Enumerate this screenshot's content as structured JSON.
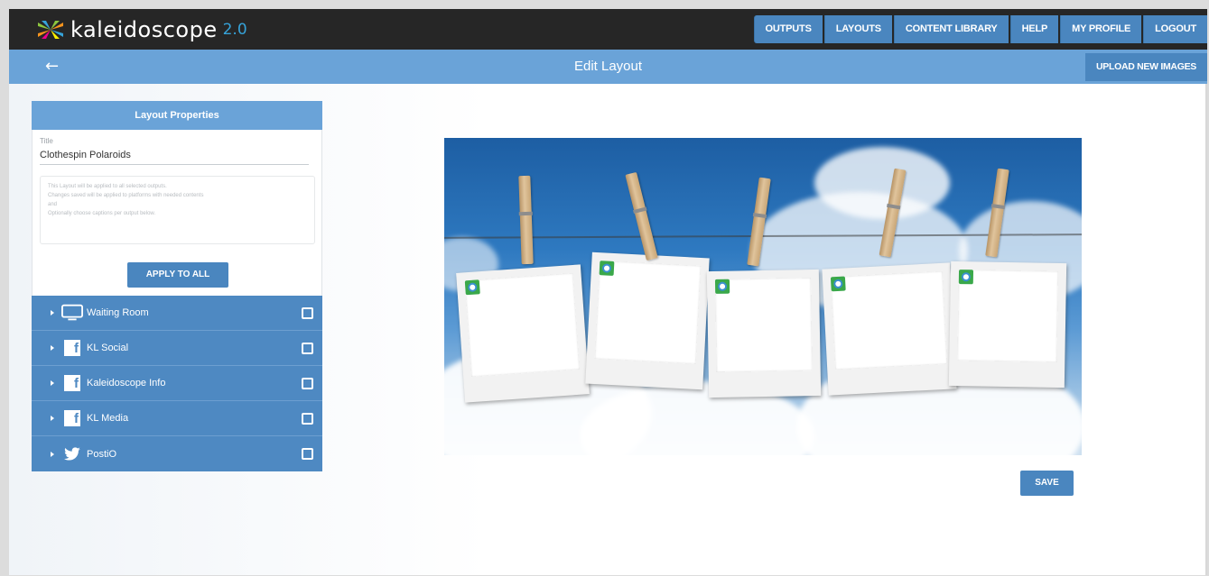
{
  "brand": {
    "name": "kaleidoscope",
    "version": "2.0",
    "logo_icon": "kaleidoscope-logo-icon"
  },
  "nav": [
    {
      "label": "OUTPUTS"
    },
    {
      "label": "LAYOUTS"
    },
    {
      "label": "CONTENT LIBRARY"
    },
    {
      "label": "HELP"
    },
    {
      "label": "MY PROFILE"
    },
    {
      "label": "LOGOUT"
    }
  ],
  "subbar": {
    "back_icon": "←",
    "title": "Edit Layout",
    "upload_label": "UPLOAD NEW IMAGES"
  },
  "layout_properties": {
    "header": "Layout Properties",
    "title_label": "Title",
    "title_value": "Clothespin Polaroids",
    "description_lines": [
      "This Layout will be applied to all selected outputs.",
      "Changes saved will be applied to platforms with needed contents",
      "and",
      "Optionally choose captions per output below."
    ],
    "apply_label": "APPLY TO ALL"
  },
  "outputs": [
    {
      "label": "Waiting Room",
      "icon": "monitor-icon",
      "checked": false
    },
    {
      "label": "KL Social",
      "icon": "facebook-icon",
      "checked": false
    },
    {
      "label": "Kaleidoscope Info",
      "icon": "facebook-icon",
      "checked": false
    },
    {
      "label": "KL Media",
      "icon": "facebook-icon",
      "checked": false
    },
    {
      "label": "PostiO",
      "icon": "twitter-icon",
      "checked": false
    }
  ],
  "canvas": {
    "image": "clothesline-polaroids-sky",
    "frame_count": 5
  },
  "save_label": "SAVE",
  "colors": {
    "topbar": "#262626",
    "accent": "#4a86bf",
    "subbar": "#6aa3d8",
    "logo_version": "#36a3d9"
  }
}
